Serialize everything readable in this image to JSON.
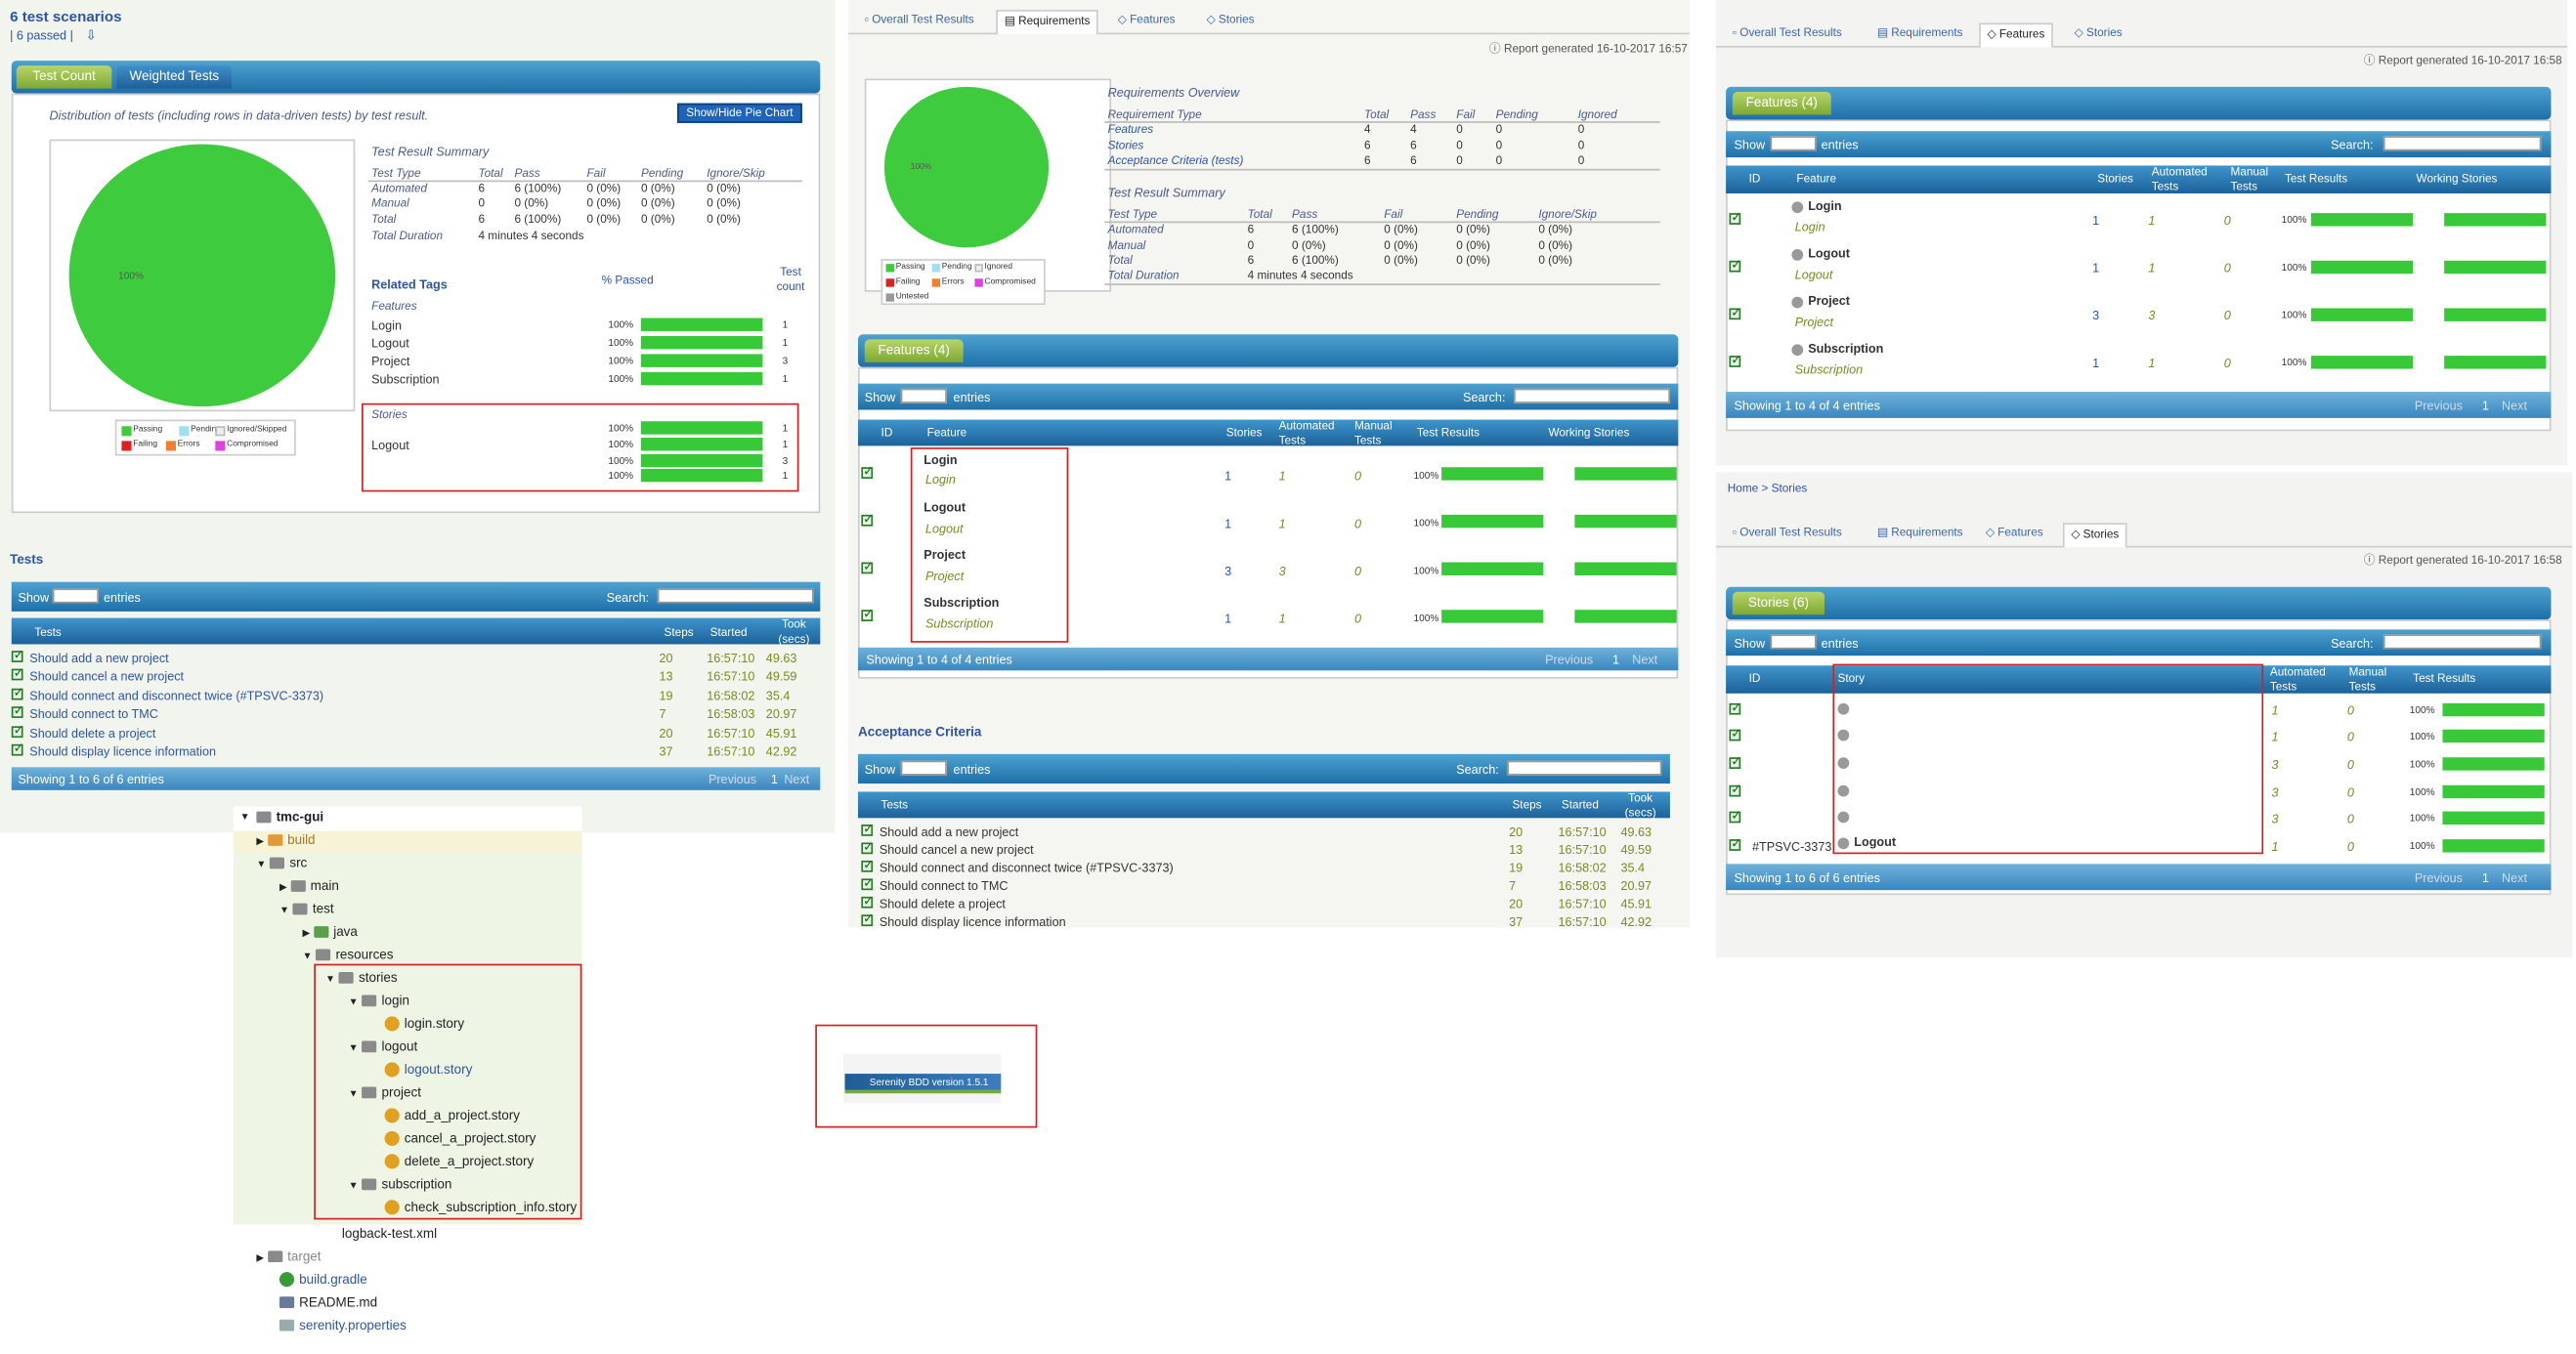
{
  "left": {
    "title": "6 test scenarios",
    "passed": "| 6 passed |",
    "tabs": [
      "Test Count",
      "Weighted Tests"
    ],
    "dist_note": "Distribution of tests (including rows in data-driven tests) by test result.",
    "pie_button": "Show/Hide Pie Chart",
    "pie_label": "100%",
    "legend": [
      "Passing",
      "Pending",
      "Ignored/Skipped",
      "Failing",
      "Errors",
      "Compromised"
    ],
    "summary_title": "Test Result Summary",
    "summary_head": [
      "Test Type",
      "Total",
      "Pass",
      "Fail",
      "Pending",
      "Ignore/Skip"
    ],
    "summary_rows": [
      [
        "Automated",
        "6",
        "6 (100%)",
        "0 (0%)",
        "0 (0%)",
        "0 (0%)"
      ],
      [
        "Manual",
        "0",
        "0 (0%)",
        "0 (0%)",
        "0 (0%)",
        "0 (0%)"
      ],
      [
        "Total",
        "6",
        "6 (100%)",
        "0 (0%)",
        "0 (0%)",
        "0 (0%)"
      ]
    ],
    "duration_label": "Total Duration",
    "duration": "4 minutes 4 seconds",
    "related_tags": "Related Tags",
    "passed_col": "% Passed",
    "count_col": "Test count",
    "features_label": "Features",
    "features": [
      [
        "Login",
        "100%",
        "1"
      ],
      [
        "Logout",
        "100%",
        "1"
      ],
      [
        "Project",
        "100%",
        "3"
      ],
      [
        "Subscription",
        "100%",
        "1"
      ]
    ],
    "stories_label": "Stories",
    "stories": [
      [
        "",
        "100%",
        "1"
      ],
      [
        "Logout",
        "100%",
        "1"
      ],
      [
        "",
        "100%",
        "3"
      ],
      [
        "",
        "100%",
        "1"
      ]
    ],
    "tests_title": "Tests",
    "show": "Show",
    "entries": "entries",
    "search": "Search:",
    "tests_head": [
      "Tests",
      "Steps",
      "Started",
      "Took (secs)"
    ],
    "tests": [
      [
        "Should add a new project",
        "20",
        "16:57:10",
        "49.63"
      ],
      [
        "Should cancel a new project",
        "13",
        "16:57:10",
        "49.59"
      ],
      [
        "Should connect and disconnect twice (#TPSVC-3373)",
        "19",
        "16:58:02",
        "35.4"
      ],
      [
        "Should connect to TMC",
        "7",
        "16:58:03",
        "20.97"
      ],
      [
        "Should delete a project",
        "20",
        "16:57:10",
        "45.91"
      ],
      [
        "Should display licence information",
        "37",
        "16:57:10",
        "42.92"
      ]
    ],
    "showing": "Showing 1 to 6 of 6 entries",
    "prev": "Previous",
    "page": "1",
    "next": "Next"
  },
  "tree": {
    "root": "tmc-gui",
    "build": "build",
    "src": "src",
    "main": "main",
    "test": "test",
    "java": "java",
    "resources": "resources",
    "stories": "stories",
    "login": "login",
    "login_story": "login.story",
    "logout": "logout",
    "logout_story": "logout.story",
    "project": "project",
    "p1": "add_a_project.story",
    "p2": "cancel_a_project.story",
    "p3": "delete_a_project.story",
    "subscription": "subscription",
    "sub_story": "check_subscription_info.story",
    "logback": "logback-test.xml",
    "target": "target",
    "gradle": "build.gradle",
    "readme": "README.md",
    "props": "serenity.properties"
  },
  "middle": {
    "tabs": [
      "Overall Test Results",
      "Requirements",
      "Features",
      "Stories"
    ],
    "report": "Report generated 16-10-2017 16:57",
    "pie_label": "100%",
    "legend": [
      "Passing",
      "Pending",
      "Ignored",
      "Failing",
      "Errors",
      "Compromised",
      "Untested"
    ],
    "req_title": "Requirements Overview",
    "req_head": [
      "Requirement Type",
      "Total",
      "Pass",
      "Fail",
      "Pending",
      "Ignored"
    ],
    "req_rows": [
      [
        "Features",
        "4",
        "4",
        "0",
        "0",
        "0"
      ],
      [
        "Stories",
        "6",
        "6",
        "0",
        "0",
        "0"
      ],
      [
        "Acceptance Criteria (tests)",
        "6",
        "6",
        "0",
        "0",
        "0"
      ]
    ],
    "summary_title": "Test Result Summary",
    "summary_head": [
      "Test Type",
      "Total",
      "Pass",
      "Fail",
      "Pending",
      "Ignore/Skip"
    ],
    "summary_rows": [
      [
        "Automated",
        "6",
        "6 (100%)",
        "0 (0%)",
        "0 (0%)",
        "0 (0%)"
      ],
      [
        "Manual",
        "0",
        "0 (0%)",
        "0 (0%)",
        "0 (0%)",
        "0 (0%)"
      ],
      [
        "Total",
        "6",
        "6 (100%)",
        "0 (0%)",
        "0 (0%)",
        "0 (0%)"
      ]
    ],
    "duration_label": "Total Duration",
    "duration": "4 minutes 4 seconds",
    "features_tab": "Features (4)",
    "feat_head": [
      "ID",
      "Feature",
      "Stories",
      "Automated Tests",
      "Manual Tests",
      "Test Results",
      "Working Stories"
    ],
    "features": [
      [
        "Login",
        "Login",
        "1",
        "1",
        "0",
        "100%"
      ],
      [
        "Logout",
        "Logout",
        "1",
        "1",
        "0",
        "100%"
      ],
      [
        "Project",
        "Project",
        "3",
        "3",
        "0",
        "100%"
      ],
      [
        "Subscription",
        "Subscription",
        "1",
        "1",
        "0",
        "100%"
      ]
    ],
    "showing": "Showing 1 to 4 of 4 entries",
    "prev": "Previous",
    "page": "1",
    "next": "Next",
    "ac_title": "Acceptance Criteria",
    "tests_head": [
      "Tests",
      "Steps",
      "Started",
      "Took (secs)"
    ],
    "tests": [
      [
        "Should add a new project",
        "20",
        "16:57:10",
        "49.63"
      ],
      [
        "Should cancel a new project",
        "13",
        "16:57:10",
        "49.59"
      ],
      [
        "Should connect and disconnect twice (#TPSVC-3373)",
        "19",
        "16:58:02",
        "35.4"
      ],
      [
        "Should connect to TMC",
        "7",
        "16:58:03",
        "20.97"
      ],
      [
        "Should delete a project",
        "20",
        "16:57:10",
        "45.91"
      ],
      [
        "Should display licence information",
        "37",
        "16:57:10",
        "42.92"
      ]
    ],
    "show": "Show",
    "entries": "entries",
    "search": "Search:"
  },
  "version": "Serenity BDD version 1.5.1",
  "right_top": {
    "tabs": [
      "Overall Test Results",
      "Requirements",
      "Features",
      "Stories"
    ],
    "report": "Report generated 16-10-2017 16:58",
    "features_tab": "Features (4)",
    "head": [
      "ID",
      "Feature",
      "Stories",
      "Automated Tests",
      "Manual Tests",
      "Test Results",
      "Working Stories"
    ],
    "rows": [
      [
        "Login",
        "Login",
        "1",
        "1",
        "0",
        "100%"
      ],
      [
        "Logout",
        "Logout",
        "1",
        "1",
        "0",
        "100%"
      ],
      [
        "Project",
        "Project",
        "3",
        "3",
        "0",
        "100%"
      ],
      [
        "Subscription",
        "Subscription",
        "1",
        "1",
        "0",
        "100%"
      ]
    ],
    "showing": "Showing 1 to 4 of 4 entries",
    "prev": "Previous",
    "page": "1",
    "next": "Next",
    "show": "Show",
    "entries": "entries",
    "search": "Search:"
  },
  "right_bottom": {
    "breadcrumb": "Home > Stories",
    "tabs": [
      "Overall Test Results",
      "Requirements",
      "Features",
      "Stories"
    ],
    "report": "Report generated 16-10-2017 16:58",
    "stories_tab": "Stories (6)",
    "head": [
      "ID",
      "Story",
      "Automated Tests",
      "Manual Tests",
      "Test Results"
    ],
    "rows": [
      [
        "",
        "",
        "1",
        "0",
        "100%"
      ],
      [
        "",
        "",
        "1",
        "0",
        "100%"
      ],
      [
        "",
        "",
        "3",
        "0",
        "100%"
      ],
      [
        "",
        "",
        "3",
        "0",
        "100%"
      ],
      [
        "",
        "",
        "3",
        "0",
        "100%"
      ],
      [
        "#TPSVC-3373",
        "Logout",
        "1",
        "0",
        "100%"
      ]
    ],
    "showing": "Showing 1 to 6 of 6 entries",
    "prev": "Previous",
    "page": "1",
    "next": "Next",
    "show": "Show",
    "entries": "entries",
    "search": "Search:"
  }
}
